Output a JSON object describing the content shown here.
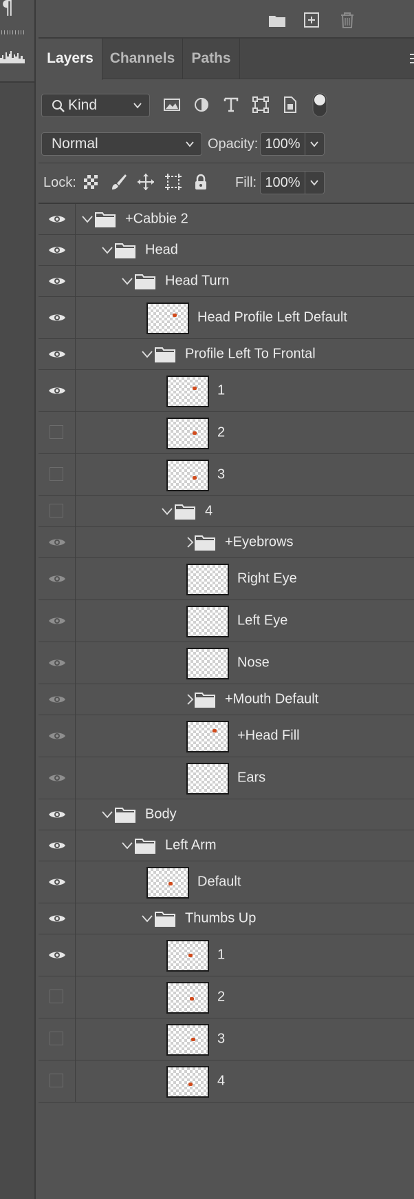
{
  "tabs": [
    {
      "label": "Layers",
      "active": true
    },
    {
      "label": "Channels",
      "active": false
    },
    {
      "label": "Paths",
      "active": false
    }
  ],
  "filter": {
    "kind_label": "Kind"
  },
  "blend": {
    "mode": "Normal",
    "opacity_label": "Opacity:",
    "opacity_value": "100%"
  },
  "lock": {
    "label": "Lock:",
    "fill_label": "Fill:",
    "fill_value": "100%"
  },
  "colors": {
    "panel": "#535353",
    "tabbar": "#474747",
    "accent_thumb": "#d14b1c"
  },
  "layers": [
    {
      "name": "+Cabbie 2",
      "type": "group",
      "depth": 0,
      "expanded": true,
      "visibility": "on"
    },
    {
      "name": "Head",
      "type": "group",
      "depth": 1,
      "expanded": true,
      "visibility": "on"
    },
    {
      "name": "Head Turn",
      "type": "group",
      "depth": 2,
      "expanded": true,
      "visibility": "on"
    },
    {
      "name": "Head Profile Left Default",
      "type": "layer",
      "depth": 3,
      "visibility": "on"
    },
    {
      "name": "Profile Left To Frontal",
      "type": "group",
      "depth": 3,
      "expanded": true,
      "visibility": "on"
    },
    {
      "name": "1",
      "type": "layer",
      "depth": 4,
      "visibility": "on"
    },
    {
      "name": "2",
      "type": "layer",
      "depth": 4,
      "visibility": "off"
    },
    {
      "name": "3",
      "type": "layer",
      "depth": 4,
      "visibility": "off"
    },
    {
      "name": "4",
      "type": "group",
      "depth": 4,
      "expanded": true,
      "visibility": "off"
    },
    {
      "name": "+Eyebrows",
      "type": "group",
      "depth": 5,
      "expanded": false,
      "visibility": "dim"
    },
    {
      "name": "Right Eye",
      "type": "layer",
      "depth": 5,
      "visibility": "dim"
    },
    {
      "name": "Left Eye",
      "type": "layer",
      "depth": 5,
      "visibility": "dim"
    },
    {
      "name": "Nose",
      "type": "layer",
      "depth": 5,
      "visibility": "dim"
    },
    {
      "name": "+Mouth Default",
      "type": "group",
      "depth": 5,
      "expanded": false,
      "visibility": "dim"
    },
    {
      "name": "+Head Fill",
      "type": "layer",
      "depth": 5,
      "visibility": "dim"
    },
    {
      "name": "Ears",
      "type": "layer",
      "depth": 5,
      "visibility": "dim"
    },
    {
      "name": "Body",
      "type": "group",
      "depth": 1,
      "expanded": true,
      "visibility": "on"
    },
    {
      "name": "Left Arm",
      "type": "group",
      "depth": 2,
      "expanded": true,
      "visibility": "on"
    },
    {
      "name": "Default",
      "type": "layer",
      "depth": 3,
      "visibility": "on"
    },
    {
      "name": "Thumbs Up",
      "type": "group",
      "depth": 3,
      "expanded": true,
      "visibility": "on"
    },
    {
      "name": "1",
      "type": "layer",
      "depth": 4,
      "visibility": "on"
    },
    {
      "name": "2",
      "type": "layer",
      "depth": 4,
      "visibility": "off"
    },
    {
      "name": "3",
      "type": "layer",
      "depth": 4,
      "visibility": "off"
    },
    {
      "name": "4",
      "type": "layer",
      "depth": 4,
      "visibility": "off"
    }
  ]
}
